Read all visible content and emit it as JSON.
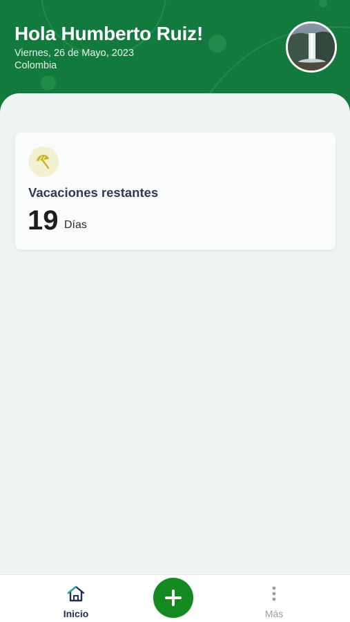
{
  "header": {
    "greeting": "Hola Humberto Ruiz!",
    "date": "Viernes, 26 de Mayo, 2023",
    "country": "Colombia",
    "background_color": "#137a3e",
    "avatar_icon": "waterfall-photo"
  },
  "vacation_card": {
    "icon": "beach-umbrella-icon",
    "title": "Vacaciones restantes",
    "value": "19",
    "unit": "Días"
  },
  "bottom_nav": {
    "home_label": "Inicio",
    "home_icon": "home-icon",
    "add_icon": "plus-icon",
    "more_label": "Más",
    "more_icon": "more-vertical-icon",
    "active_color": "#1f2d5a",
    "fab_color": "#14891f"
  }
}
